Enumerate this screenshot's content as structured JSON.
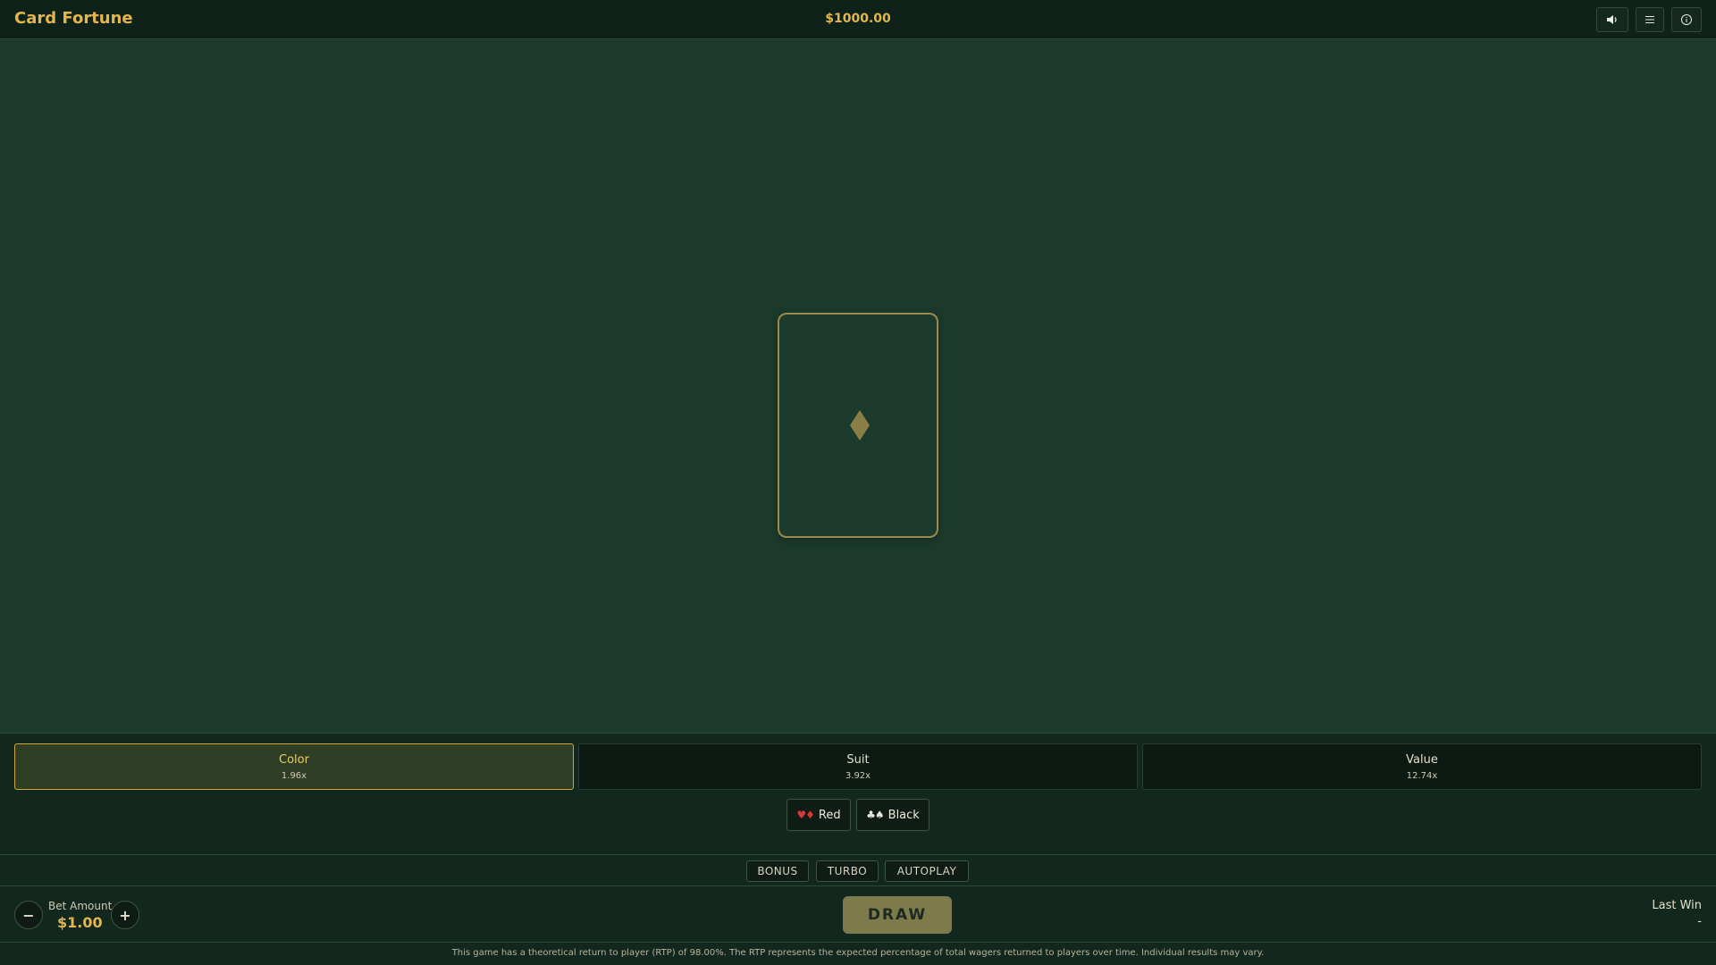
{
  "header": {
    "title": "Card Fortune",
    "balance": "$1000.00",
    "buttons": [
      {
        "icon": "speaker-icon"
      },
      {
        "icon": "menu-icon"
      },
      {
        "icon": "info-icon"
      }
    ]
  },
  "table": {
    "card": {
      "state": "face-down",
      "back_icon": "diamond-icon"
    }
  },
  "bet_types": [
    {
      "label": "Color",
      "multiplier": "1.96x",
      "selected": true
    },
    {
      "label": "Suit",
      "multiplier": "3.92x",
      "selected": false
    },
    {
      "label": "Value",
      "multiplier": "12.74x",
      "selected": false
    }
  ],
  "choices": [
    {
      "label": "Red",
      "suits": "♥♦"
    },
    {
      "label": "Black",
      "suits": "♣♠"
    }
  ],
  "features": [
    "BONUS",
    "TURBO",
    "AUTOPLAY"
  ],
  "controls": {
    "decrease": "−",
    "increase": "+",
    "bet_label": "Bet Amount",
    "bet_value": "$1.00",
    "draw_label": "DRAW",
    "last_win_label": "Last Win",
    "last_win_value": "-"
  },
  "footer": {
    "rtp_text": "This game has a theoretical return to player (RTP) of 98.00%. The RTP represents the expected percentage of total wagers returned to players over time. Individual results may vary."
  },
  "colors": {
    "accent": "#e3b64d",
    "table": "#1b3a2b",
    "panel": "#12271d",
    "red_suit": "#d9383a"
  }
}
